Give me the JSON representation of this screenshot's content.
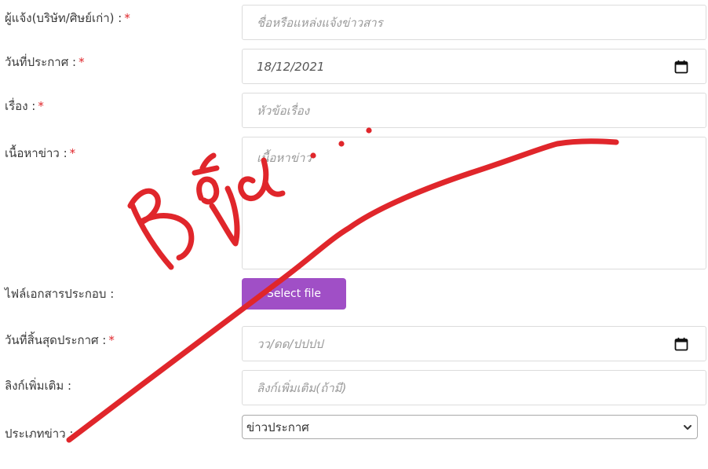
{
  "form": {
    "reporter": {
      "label": "ผู้แจ้ง(บริษัท/ศิษย์เก่า) :",
      "required": "*",
      "placeholder": "ชื่อหรือแหล่งแจ้งข่าวสาร"
    },
    "announce_date": {
      "label": "วันที่ประกาศ :",
      "required": "*",
      "value": "18/12/2021"
    },
    "subject": {
      "label": "เรื่อง :",
      "required": "*",
      "placeholder": "หัวข้อเรื่อง"
    },
    "content": {
      "label": "เนื้อหาข่าว :",
      "required": "*",
      "placeholder": "เนื้อหาข่าว"
    },
    "attachment": {
      "label": "ไฟล์เอกสารประกอบ :",
      "button_label": "Select file"
    },
    "end_date": {
      "label": "วันที่สิ้นสุดประกาศ :",
      "required": "*",
      "placeholder": "วว/ดด/ปปปป"
    },
    "extra_link": {
      "label": "ลิงก์เพิ่มเติม :",
      "placeholder": "ลิงก์เพิ่มเติม(ถ้ามี)"
    },
    "news_type": {
      "label": "ประเภทข่าว :",
      "selected": "ข่าวประกาศ"
    }
  },
  "colors": {
    "required_marker": "#e0262b",
    "file_button": "#a04fc6",
    "annotation_ink": "#e0262b"
  },
  "icons": {
    "calendar": "calendar-icon",
    "select_arrow": "chevron-down-icon"
  },
  "annotation": {
    "handwritten_text": "Bถa"
  }
}
